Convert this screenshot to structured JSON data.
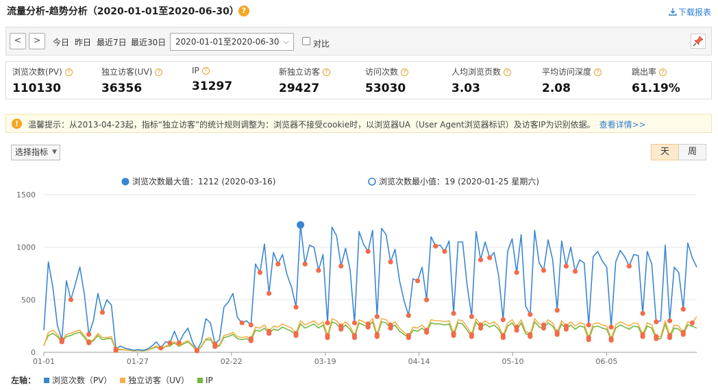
{
  "header": {
    "title": "流量分析-趋势分析（2020-01-01至2020-06-30）",
    "help": "?",
    "download_label": "下载报表"
  },
  "toolbar": {
    "prev": "<",
    "next": ">",
    "quick_ranges": [
      "今日",
      "昨日",
      "最近7日",
      "最近30日"
    ],
    "date_range": "2020-01-01至2020-06-30",
    "compare_label": "对比"
  },
  "metrics": [
    {
      "label": "浏览次数(PV)",
      "value": "110130"
    },
    {
      "label": "独立访客(UV)",
      "value": "36356"
    },
    {
      "label": "IP",
      "value": "31297"
    },
    {
      "label": "新独立访客",
      "value": "29427"
    },
    {
      "label": "访问次数",
      "value": "53030"
    },
    {
      "label": "人均浏览页数",
      "value": "3.03"
    },
    {
      "label": "平均访问深度",
      "value": "2.08"
    },
    {
      "label": "跳出率",
      "value": "61.19%"
    }
  ],
  "notice": {
    "text": "温馨提示：从2013-04-23起，指标“独立访客”的统计规则调整为：浏览器不接受cookie时，以浏览器UA（User Agent浏览器标识）及访客IP为识别依据。",
    "link": "查看详情>>"
  },
  "controls": {
    "metric_select": "选择指标",
    "granularity": [
      "天",
      "周"
    ],
    "active_granularity": "天"
  },
  "chart_data": {
    "type": "line",
    "max_label": "浏览次数最大值：1212 (2020-03-16)",
    "min_label": "浏览次数最小值：19 (2020-01-25 星期六)",
    "x_tick_labels": [
      "01-01",
      "01-27",
      "02-22",
      "03-19",
      "04-14",
      "05-10",
      "06-05"
    ],
    "ylim": [
      0,
      1500
    ],
    "y_ticks": [
      0,
      500,
      1000,
      1500
    ],
    "grid": true,
    "axis_label": "左轴：",
    "colors": {
      "pv": "#3a86d1",
      "uv": "#f0b04a",
      "ip": "#72b83c",
      "marker": "#f26b4b"
    },
    "series": [
      {
        "name": "浏览次数（PV）",
        "values": [
          210,
          860,
          620,
          260,
          120,
          680,
          500,
          650,
          810,
          550,
          170,
          300,
          560,
          380,
          500,
          450,
          30,
          60,
          40,
          30,
          20,
          25,
          19,
          30,
          60,
          100,
          40,
          100,
          90,
          200,
          90,
          170,
          230,
          100,
          20,
          100,
          320,
          280,
          80,
          120,
          430,
          480,
          560,
          330,
          280,
          300,
          260,
          840,
          760,
          1030,
          560,
          950,
          840,
          930,
          740,
          620,
          430,
          1212,
          840,
          1020,
          1000,
          780,
          930,
          280,
          1190,
          1110,
          820,
          990,
          790,
          280,
          1150,
          1030,
          960,
          1160,
          340,
          1180,
          1120,
          860,
          980,
          680,
          490,
          350,
          700,
          680,
          810,
          500,
          1100,
          1010,
          1020,
          960,
          1060,
          370,
          1050,
          1050,
          640,
          340,
          1150,
          880,
          1050,
          900,
          950,
          730,
          310,
          960,
          1080,
          760,
          1120,
          440,
          360,
          1160,
          850,
          780,
          1070,
          880,
          400,
          1060,
          820,
          1000,
          770,
          880,
          850,
          260,
          910,
          960,
          870,
          810,
          240,
          860,
          970,
          910,
          820,
          930,
          920,
          370,
          960,
          840,
          290,
          300,
          1020,
          300,
          810,
          760,
          410,
          1040,
          900,
          810
        ]
      },
      {
        "name": "独立访客（UV）",
        "values": [
          60,
          190,
          210,
          170,
          110,
          170,
          180,
          200,
          210,
          160,
          100,
          120,
          180,
          140,
          140,
          150,
          20,
          30,
          25,
          20,
          15,
          18,
          16,
          22,
          40,
          60,
          30,
          60,
          70,
          100,
          60,
          90,
          110,
          70,
          15,
          60,
          130,
          140,
          60,
          70,
          160,
          170,
          190,
          150,
          140,
          150,
          130,
          240,
          230,
          260,
          200,
          250,
          240,
          270,
          250,
          230,
          180,
          300,
          260,
          280,
          300,
          260,
          290,
          160,
          320,
          300,
          250,
          290,
          250,
          160,
          310,
          290,
          270,
          320,
          170,
          320,
          310,
          260,
          290,
          230,
          190,
          160,
          240,
          230,
          260,
          210,
          310,
          300,
          300,
          290,
          300,
          180,
          310,
          300,
          240,
          170,
          320,
          260,
          300,
          270,
          290,
          250,
          160,
          280,
          310,
          240,
          310,
          200,
          170,
          320,
          270,
          260,
          310,
          280,
          190,
          300,
          250,
          290,
          250,
          280,
          270,
          140,
          270,
          280,
          260,
          250,
          130,
          260,
          290,
          270,
          250,
          280,
          270,
          170,
          280,
          260,
          150,
          150,
          300,
          160,
          260,
          250,
          190,
          290,
          280,
          340
        ]
      },
      {
        "name": "IP",
        "values": [
          70,
          160,
          180,
          150,
          100,
          150,
          160,
          180,
          190,
          140,
          90,
          110,
          160,
          120,
          130,
          130,
          18,
          25,
          22,
          18,
          14,
          16,
          14,
          20,
          35,
          50,
          25,
          55,
          60,
          90,
          55,
          80,
          100,
          60,
          14,
          55,
          120,
          120,
          55,
          60,
          140,
          150,
          170,
          130,
          120,
          130,
          110,
          210,
          200,
          230,
          180,
          220,
          210,
          240,
          220,
          200,
          160,
          270,
          230,
          250,
          270,
          230,
          260,
          140,
          290,
          270,
          220,
          260,
          220,
          140,
          280,
          260,
          240,
          290,
          150,
          290,
          280,
          230,
          260,
          200,
          170,
          140,
          210,
          200,
          230,
          190,
          280,
          270,
          270,
          260,
          270,
          160,
          280,
          270,
          210,
          150,
          290,
          230,
          270,
          240,
          260,
          220,
          140,
          250,
          280,
          210,
          280,
          180,
          150,
          290,
          240,
          230,
          280,
          250,
          170,
          270,
          220,
          260,
          220,
          250,
          240,
          120,
          240,
          250,
          230,
          220,
          115,
          230,
          260,
          240,
          220,
          250,
          240,
          150,
          250,
          230,
          130,
          130,
          270,
          140,
          230,
          220,
          170,
          260,
          250,
          230
        ]
      }
    ]
  },
  "bottom_legend": {
    "prefix": "左轴：",
    "items": [
      "浏览次数（PV）",
      "独立访客（UV）",
      "IP"
    ]
  }
}
